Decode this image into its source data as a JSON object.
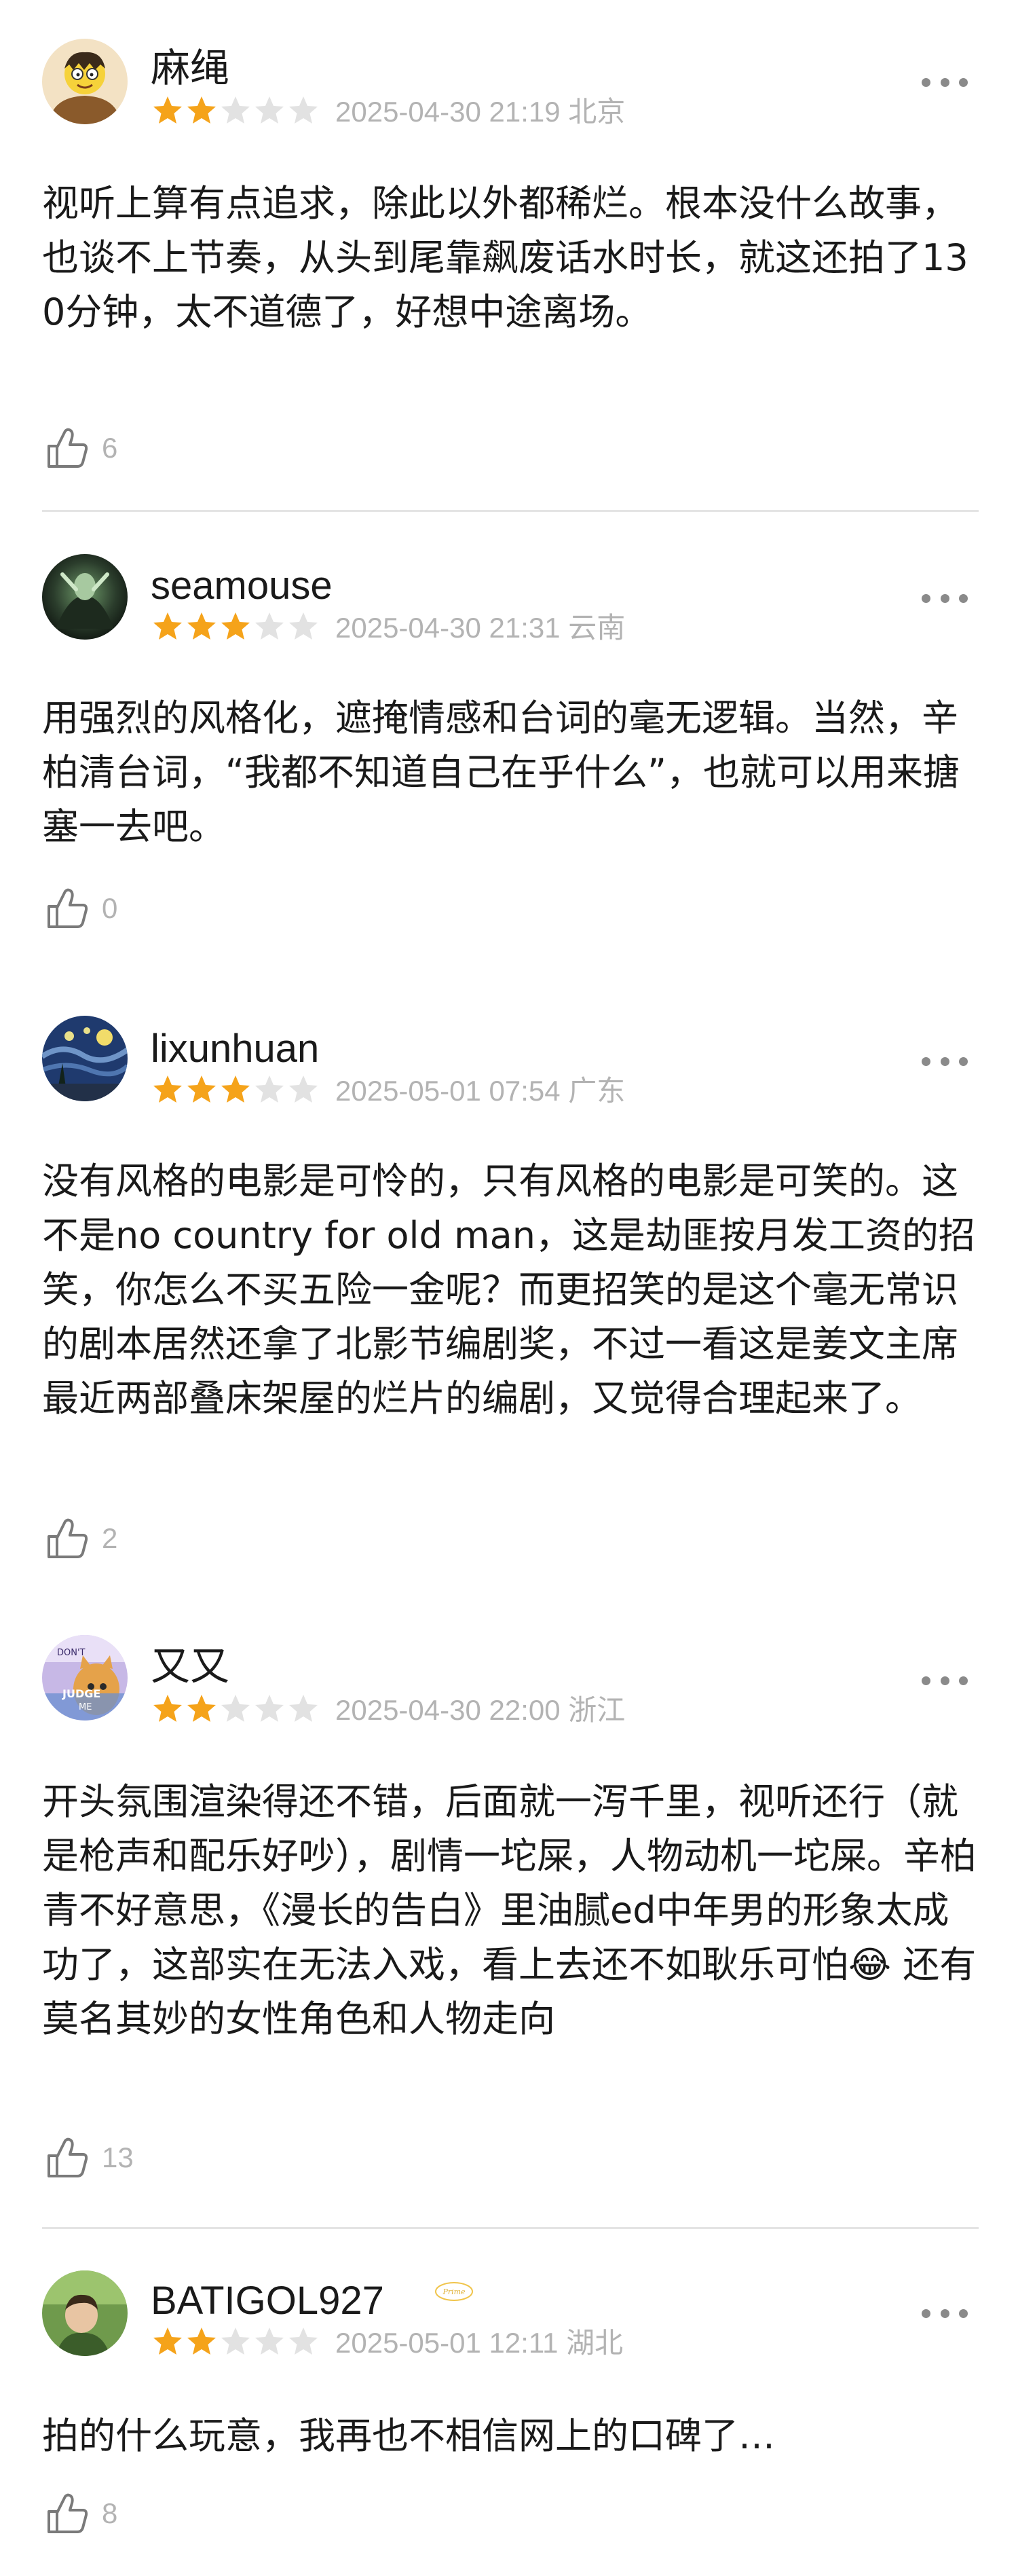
{
  "colors": {
    "star_on": "#f5a31a",
    "star_off": "#e2e2e2",
    "meta_gray": "#b3b3b3",
    "divider": "#e4e4e4",
    "vip_gold": "#f0c44a"
  },
  "reviews": [
    {
      "username": "麻绳",
      "rating": 2,
      "max_rating": 5,
      "timestamp": "2025-04-30 21:19",
      "location": "北京",
      "content": "视听上算有点追求，除此以外都稀烂。根本没什么故事，也谈不上节奏，从头到尾靠飙废话水时长，就这还拍了130分钟，太不道德了，好想中途离场。",
      "likes": "6",
      "avatar_icon": "cartoon-avatar-icon"
    },
    {
      "username": "seamouse",
      "rating": 3,
      "max_rating": 5,
      "timestamp": "2025-04-30 21:31",
      "location": "云南",
      "content": "用强烈的风格化，遮掩情感和台词的毫无逻辑。当然，辛柏清台词，“我都不知道自己在乎什么”，也就可以用来搪塞一去吧。",
      "likes": "0",
      "avatar_icon": "green-figure-avatar-icon"
    },
    {
      "username": "lixunhuan",
      "rating": 3,
      "max_rating": 5,
      "timestamp": "2025-05-01 07:54",
      "location": "广东",
      "content": "没有风格的电影是可怜的，只有风格的电影是可笑的。这不是no country for old man，这是劫匪按月发工资的招笑，你怎么不买五险一金呢？而更招笑的是这个毫无常识的剧本居然还拿了北影节编剧奖，不过一看这是姜文主席最近两部叠床架屋的烂片的编剧，又觉得合理起来了。",
      "likes": "2",
      "avatar_icon": "starry-night-avatar-icon"
    },
    {
      "username": "又又",
      "rating": 2,
      "max_rating": 5,
      "timestamp": "2025-04-30 22:00",
      "location": "浙江",
      "content": "开头氛围渲染得还不错，后面就一泻千里，视听还行（就是枪声和配乐好吵），剧情一坨屎，人物动机一坨屎。辛柏青不好意思，《漫长的告白》里油腻ed中年男的形象太成功了，这部实在无法入戏，看上去还不如耿乐可怕😂 还有莫名其妙的女性角色和人物走向",
      "likes": "13",
      "avatar_icon": "cat-judge-avatar-icon",
      "avatar_text": [
        "DON'T",
        "JUDGE",
        "ME"
      ]
    },
    {
      "username": "BATIGOL927",
      "rating": 2,
      "max_rating": 5,
      "timestamp": "2025-05-01 12:11",
      "location": "湖北",
      "content": "拍的什么玩意，我再也不相信网上的口碑了…",
      "likes": "8",
      "avatar_icon": "photo-avatar-icon",
      "badge": "Prime"
    }
  ]
}
